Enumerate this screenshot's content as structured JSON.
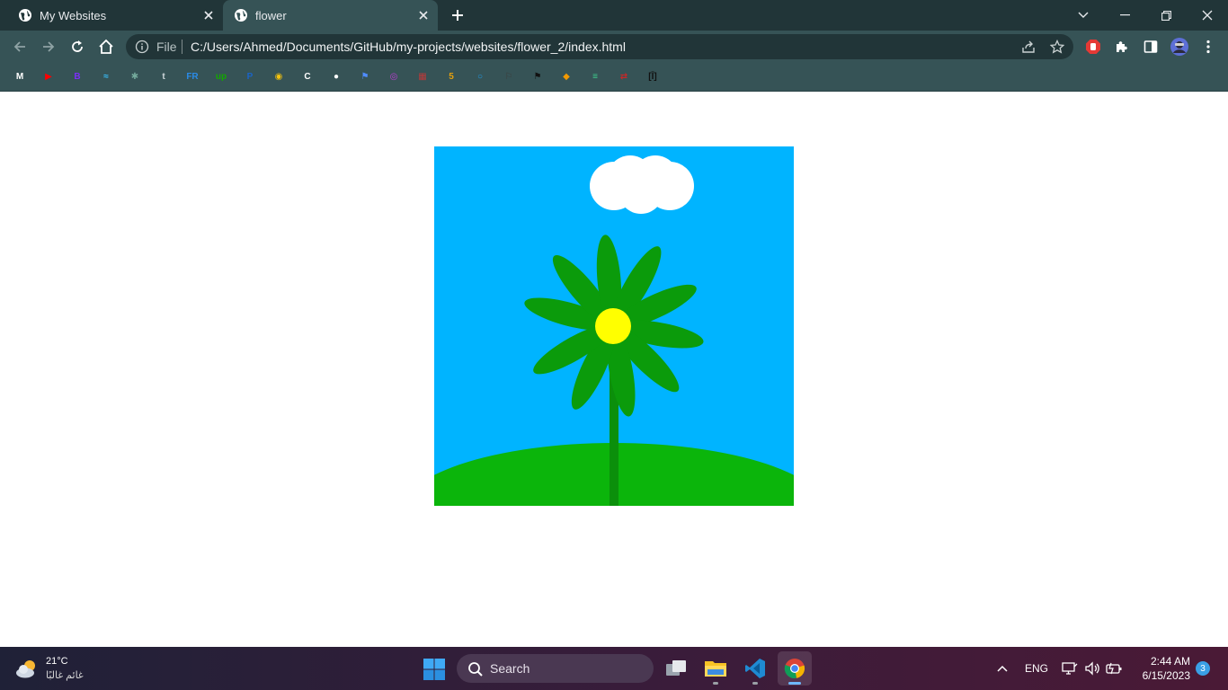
{
  "browser": {
    "tabs": [
      {
        "title": "My Websites",
        "active": false
      },
      {
        "title": "flower",
        "active": true
      }
    ],
    "address": {
      "scheme_label": "File",
      "url": "C:/Users/Ahmed/Documents/GitHub/my-projects/websites/flower_2/index.html"
    },
    "accent": "#365356",
    "frame": "#213538"
  },
  "bookmarks": [
    {
      "icon": "gmail-icon",
      "label": "M",
      "color": "#ffffff"
    },
    {
      "icon": "youtube-icon",
      "label": "▶",
      "color": "#ff0000"
    },
    {
      "icon": "bootstrap-icon",
      "label": "B",
      "color": "#7b2ff7"
    },
    {
      "icon": "tailwind-icon",
      "label": "≈",
      "color": "#38bdf8"
    },
    {
      "icon": "chatgpt-icon",
      "label": "✱",
      "color": "#74aa9c"
    },
    {
      "icon": "tumblr-icon",
      "label": "t",
      "color": "#cfd8dc"
    },
    {
      "icon": "fr-icon",
      "label": "FR",
      "color": "#2b8be6"
    },
    {
      "icon": "upwork-icon",
      "label": "up",
      "color": "#14a800"
    },
    {
      "icon": "paypal-icon",
      "label": "P",
      "color": "#1a63c5"
    },
    {
      "icon": "extension-owl-icon",
      "label": "◉",
      "color": "#f4c20d"
    },
    {
      "icon": "codeium-icon",
      "label": "C",
      "color": "#ffffff"
    },
    {
      "icon": "github-icon",
      "label": "●",
      "color": "#ffffff"
    },
    {
      "icon": "flag-icon",
      "label": "⚑",
      "color": "#4f8cff"
    },
    {
      "icon": "chat-bubble-icon",
      "label": "◎",
      "color": "#c03ad6"
    },
    {
      "icon": "grid-icon",
      "label": "▦",
      "color": "#b93a3a"
    },
    {
      "icon": "number-five-icon",
      "label": "5",
      "color": "#e5a00d"
    },
    {
      "icon": "circle-icon",
      "label": "○",
      "color": "#1e9be9"
    },
    {
      "icon": "dark-flag-icon",
      "label": "⚐",
      "color": "#3d3d3d"
    },
    {
      "icon": "black-flag-icon",
      "label": "⚑",
      "color": "#111111"
    },
    {
      "icon": "diamond-icon",
      "label": "◆",
      "color": "#f29900"
    },
    {
      "icon": "stripes-icon",
      "label": "≡",
      "color": "#3ecf8e"
    },
    {
      "icon": "toggle-icon",
      "label": "⇄",
      "color": "#c62828"
    },
    {
      "icon": "bracket-icon",
      "label": "[Ī]",
      "color": "#111111"
    }
  ],
  "scene": {
    "sky": "#00b4ff",
    "cloud": "#ffffff",
    "grass": "#0bb50b",
    "petal": "#0b9b0b",
    "stem": "#0b8f0b",
    "center": "#ffff00"
  },
  "taskbar": {
    "weather": {
      "temp": "21°C",
      "desc": "غائم غالبًا"
    },
    "search_placeholder": "Search",
    "language": "ENG",
    "time": "2:44 AM",
    "date": "6/15/2023",
    "notifications": "3"
  }
}
